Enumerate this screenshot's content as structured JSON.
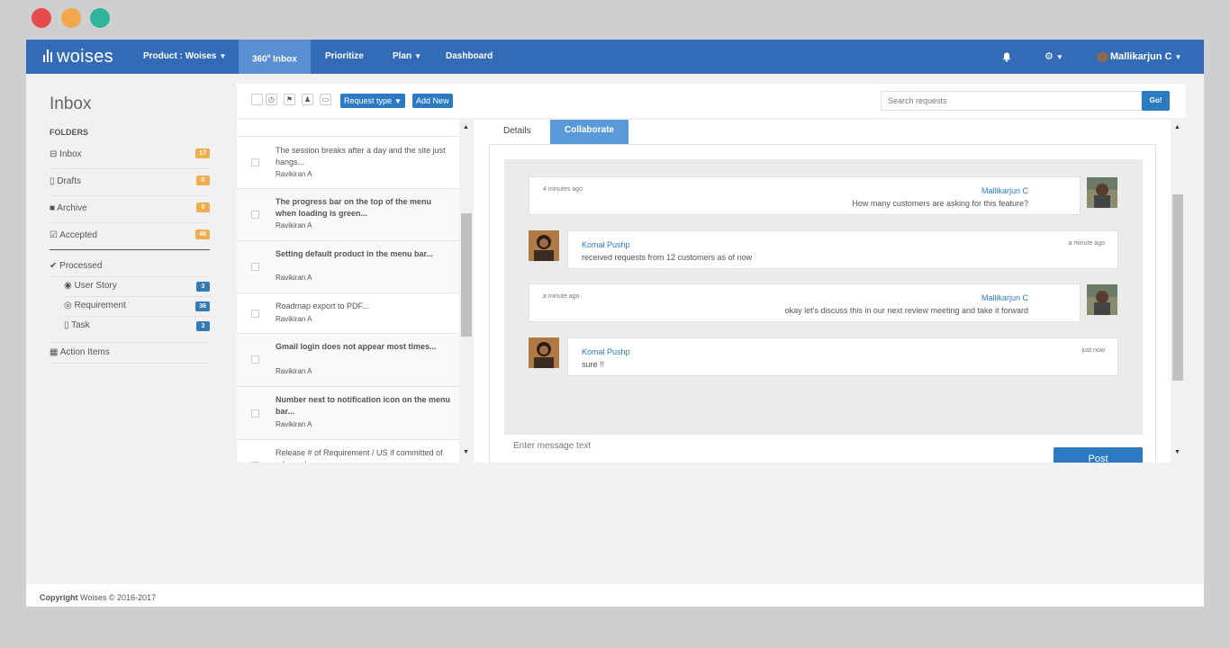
{
  "window": {
    "traffic_lights": [
      "#e74c4c",
      "#f1a84b",
      "#2eb59c"
    ]
  },
  "navbar": {
    "logo": "woises",
    "product": "Product : Woises",
    "inbox_tab": "360",
    "inbox_tab_sup": "o",
    "inbox_tab_suffix": " Inbox",
    "prioritize": "Prioritize",
    "plan": "Plan",
    "dashboard": "Dashboard",
    "user": "Mallikarjun C",
    "bg_color": "#346bb7"
  },
  "sidebar": {
    "title": "Inbox",
    "folders_label": "FOLDERS",
    "folders": [
      {
        "label": "Inbox",
        "count": "17"
      },
      {
        "label": "Drafts",
        "count": "0"
      },
      {
        "label": "Archive",
        "count": "0"
      },
      {
        "label": "Accepted",
        "count": "40"
      }
    ],
    "processed": "Processed",
    "processed_items": [
      {
        "label": "User Story",
        "count": "3"
      },
      {
        "label": "Requirement",
        "count": "36"
      },
      {
        "label": "Task",
        "count": "3"
      }
    ],
    "action_items": "Action Items"
  },
  "toolbar": {
    "request_type": "Request type",
    "add_new": "Add New",
    "search_placeholder": "Search requests",
    "go": "Go!"
  },
  "requests": [
    {
      "text": "The session breaks after a day and the site just hangs...",
      "author": "Ravikiran A",
      "bold": false
    },
    {
      "text": "The progress bar on the top of the menu when loading is green...",
      "author": "Ravikiran A",
      "bold": true
    },
    {
      "text": "Setting default product in the menu bar...",
      "author": "Ravikiran A",
      "bold": true
    },
    {
      "text": "Roadmap export to PDF...",
      "author": "Ravikiran A",
      "bold": false
    },
    {
      "text": "Gmail login does not appear most times...",
      "author": "Ravikiran A",
      "bold": true
    },
    {
      "text": "Number next to notification icon on the menu bar...",
      "author": "Ravikiran A",
      "bold": true
    },
    {
      "text": "Release # of Requirement / US if committed of released....",
      "author": "",
      "bold": false
    }
  ],
  "detail": {
    "tabs": [
      "Details",
      "Collaborate"
    ],
    "messages": [
      {
        "side": "right",
        "time": "4 minutes ago",
        "name": "Mallikarjun C",
        "text": "How many customers are asking for this feature?"
      },
      {
        "side": "left",
        "time": "a minute ago",
        "name": "Komal Pushp",
        "text": "received requests from 12 customers as of now"
      },
      {
        "side": "right",
        "time": "a minute ago",
        "name": "Mallikarjun C",
        "text": "okay let's discuss this in our next review meeting and take it forward"
      },
      {
        "side": "left",
        "time": "just now",
        "name": "Komal Pushp",
        "text": "sure !!"
      }
    ],
    "input_placeholder": "Enter message text",
    "post": "Post"
  },
  "footer": {
    "copyright_bold": "Copyright",
    "copyright_rest": " Woises © 2016-2017"
  }
}
